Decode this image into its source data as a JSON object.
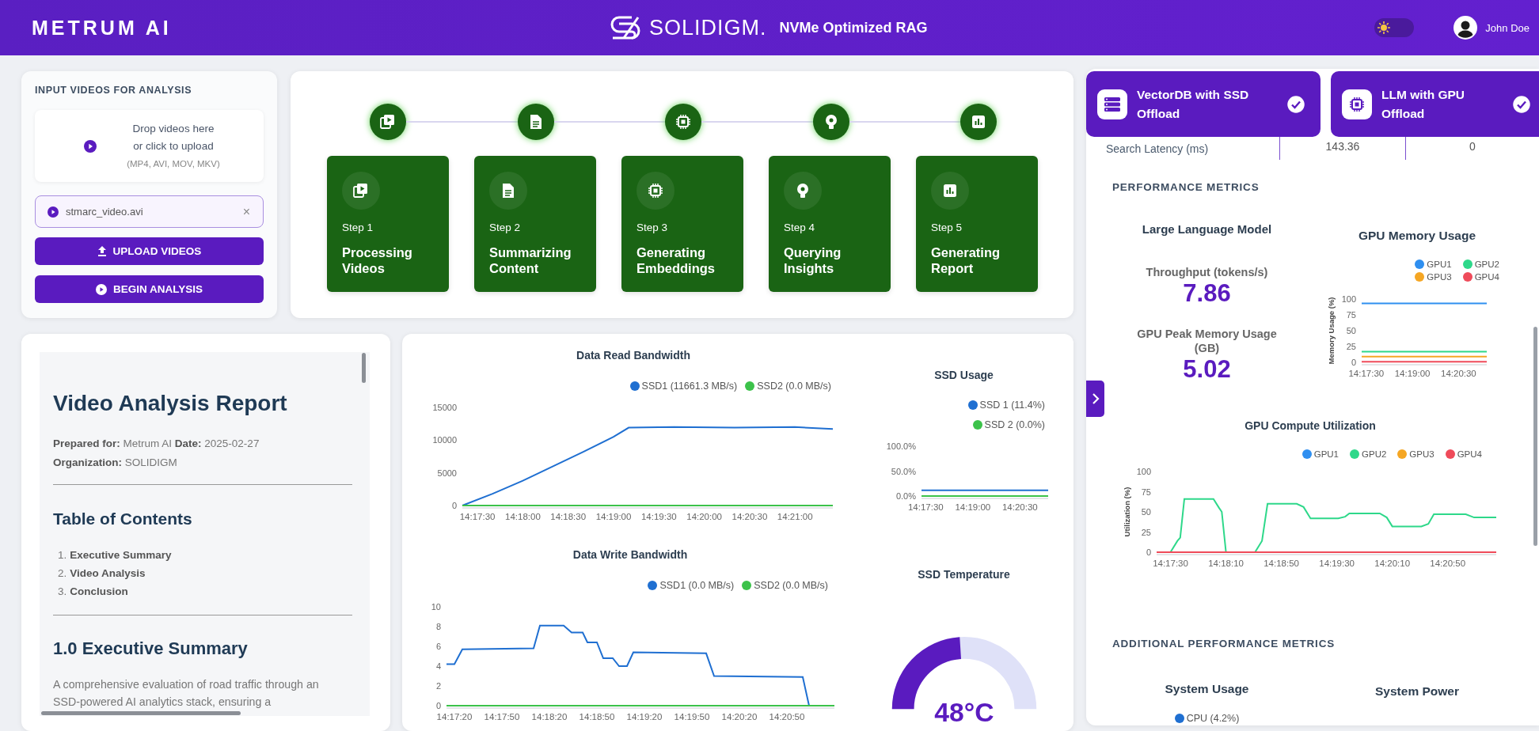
{
  "header": {
    "logo": "METRUM AI",
    "brand": "SOLIDIGM.",
    "app_title": "NVMe Optimized RAG",
    "theme_toggle": {
      "on": false
    },
    "user": "John Doe"
  },
  "input_panel": {
    "heading": "INPUT VIDEOS FOR ANALYSIS",
    "drop_zone": {
      "lines": [
        "Drop videos here",
        "or click to upload"
      ],
      "formats": "(MP4, AVI, MOV, MKV)"
    },
    "files": [
      {
        "name": "stmarc_video.avi",
        "remove": "×"
      }
    ],
    "buttons": [
      {
        "kind": "upload",
        "label": "UPLOAD VIDEOS"
      },
      {
        "kind": "analyze",
        "label": "BEGIN ANALYSIS"
      }
    ]
  },
  "pipeline": {
    "steps": [
      {
        "kind": "video",
        "step": "Step 1",
        "title": "Processing Videos",
        "completed": true
      },
      {
        "kind": "document",
        "step": "Step 2",
        "title": "Summarizing Content",
        "completed": true
      },
      {
        "kind": "chip",
        "step": "Step 3",
        "title": "Generating Embeddings",
        "completed": true
      },
      {
        "kind": "bulb",
        "step": "Step 4",
        "title": "Querying Insights",
        "completed": true
      },
      {
        "kind": "chart",
        "step": "Step 5",
        "title": "Generating Report",
        "completed": true
      }
    ]
  },
  "report": {
    "title": "Video Analysis Report",
    "meta": [
      "**Prepared for:** Metrum AI **Date:** 2025-02-27",
      "**Organization:** SOLIDIGM"
    ],
    "toc_title": "Table of Contents",
    "toc": [
      {
        "number": "1.",
        "label": "Executive Summary"
      },
      {
        "number": "2.",
        "label": "Video Analysis"
      },
      {
        "number": "3.",
        "label": "Conclusion"
      }
    ],
    "section_title": "1.0 Executive Summary",
    "paragraph": "A comprehensive evaluation of road traffic through an SSD-powered AI analytics stack, ensuring a"
  },
  "storage_charts": {
    "read_bandwidth": {
      "chart_data": {
        "type": "line",
        "title": "Data Read Bandwidth",
        "x": [
          51440,
          51460,
          51480,
          51500,
          51520,
          51540,
          51550,
          51580,
          51620,
          51660,
          51685
        ],
        "xlim": [
          51440,
          51685
        ],
        "ylim": [
          0,
          15000
        ],
        "legend": "top-right",
        "xticks": [
          {
            "value": 51450,
            "label": "14:17:30"
          },
          {
            "value": 51480,
            "label": "14:18:00"
          },
          {
            "value": 51510,
            "label": "14:18:30"
          },
          {
            "value": 51540,
            "label": "14:19:00"
          },
          {
            "value": 51570,
            "label": "14:19:30"
          },
          {
            "value": 51600,
            "label": "14:20:00"
          },
          {
            "value": 51630,
            "label": "14:20:30"
          },
          {
            "value": 51660,
            "label": "14:21:00"
          }
        ],
        "yticks": [
          0,
          5000,
          10000,
          15000
        ],
        "series": [
          {
            "name": "SSD1 (11661.3 MB/s)",
            "color": "#1f6fd1",
            "values": [
              0,
              1800,
              3800,
              6000,
              8200,
              10500,
              11900,
              12000,
              11900,
              12000,
              11700
            ]
          },
          {
            "name": "SSD2 (0.0 MB/s)",
            "color": "#3cc24a",
            "values": [
              0,
              0,
              0,
              0,
              0,
              0,
              0,
              0,
              0,
              0,
              0
            ]
          }
        ]
      }
    },
    "write_bandwidth": {
      "chart_data": {
        "type": "line",
        "title": "Data Write Bandwidth",
        "x": [
          51435,
          51440,
          51445,
          51490,
          51494,
          51509,
          51514,
          51521,
          51524,
          51530,
          51534,
          51540,
          51544,
          51549,
          51553,
          51599,
          51604,
          51660,
          51664,
          51680
        ],
        "xlim": [
          51435,
          51680
        ],
        "ylim": [
          0,
          10
        ],
        "legend": "top-right",
        "xticks": [
          {
            "value": 51440,
            "label": "14:17:20"
          },
          {
            "value": 51470,
            "label": "14:17:50"
          },
          {
            "value": 51500,
            "label": "14:18:20"
          },
          {
            "value": 51530,
            "label": "14:18:50"
          },
          {
            "value": 51560,
            "label": "14:19:20"
          },
          {
            "value": 51590,
            "label": "14:19:50"
          },
          {
            "value": 51620,
            "label": "14:20:20"
          },
          {
            "value": 51650,
            "label": "14:20:50"
          }
        ],
        "yticks": [
          0,
          2,
          4,
          6,
          8,
          10
        ],
        "series": [
          {
            "name": "SSD1 (0.0 MB/s)",
            "color": "#1f6fd1",
            "values": [
              4.2,
              4.2,
              5.7,
              5.8,
              8.1,
              8.1,
              7.4,
              7.4,
              6.4,
              6.4,
              4.8,
              4.8,
              4.0,
              4.0,
              5.4,
              5.3,
              3.0,
              2.9,
              0,
              0
            ]
          },
          {
            "name": "SSD2 (0.0 MB/s)",
            "color": "#3cc24a",
            "values": [
              0,
              0,
              0,
              0,
              0,
              0,
              0,
              0,
              0,
              0,
              0,
              0,
              0,
              0,
              0,
              0,
              0,
              0,
              0,
              0
            ]
          }
        ]
      }
    },
    "ssd_usage": {
      "chart_data": {
        "type": "line",
        "title": "SSD Usage",
        "x": [
          51442,
          51684
        ],
        "xlim": [
          51442,
          51684
        ],
        "ylim": [
          0,
          100
        ],
        "legend": "top-right",
        "xticks": [
          {
            "value": 51450,
            "label": "14:17:30"
          },
          {
            "value": 51540,
            "label": "14:19:00"
          },
          {
            "value": 51630,
            "label": "14:20:30"
          }
        ],
        "yticks": [
          {
            "value": 0,
            "label": "0.0%"
          },
          {
            "value": 50,
            "label": "50.0%"
          },
          {
            "value": 100,
            "label": "100.0%"
          }
        ],
        "series": [
          {
            "name": "SSD 1 (11.4%)",
            "color": "#1f6fd1",
            "values": [
              11.4,
              11.4
            ]
          },
          {
            "name": "SSD 2 (0.0%)",
            "color": "#3cc24a",
            "values": [
              0,
              0
            ]
          }
        ]
      }
    },
    "ssd_temperature": {
      "title": "SSD Temperature",
      "reading": "48°C"
    }
  },
  "results_panel": {
    "offload_cards": [
      {
        "kind": "database",
        "title": "VectorDB with SSD Offload",
        "checked": true
      },
      {
        "kind": "chip",
        "title": "LLM with GPU Offload",
        "checked": true
      }
    ],
    "latency_row": {
      "label": "Search Latency (ms)",
      "values": [
        "143.36",
        "0"
      ]
    },
    "performance_heading": "PERFORMANCE METRICS",
    "llm": {
      "title": "Large Language Model",
      "metrics": [
        {
          "label": "Throughput (tokens/s)",
          "value": "7.86"
        },
        {
          "label": "GPU Peak Memory Usage (GB)",
          "value": "5.02"
        }
      ]
    },
    "gpu_memory": {
      "chart_data": {
        "type": "line",
        "title": "GPU Memory Usage",
        "ylabel": "Memory Usage (%)",
        "x": [
          51441,
          51685
        ],
        "xlim": [
          51441,
          51685
        ],
        "ylim": [
          0,
          100
        ],
        "legend": "top-right",
        "xticks": [
          {
            "value": 51450,
            "label": "14:17:30"
          },
          {
            "value": 51540,
            "label": "14:19:00"
          },
          {
            "value": 51630,
            "label": "14:20:30"
          }
        ],
        "yticks": [
          0,
          25,
          50,
          75,
          100
        ],
        "series": [
          {
            "name": "GPU1",
            "color": "#2f8ff0",
            "values": [
              93,
              93
            ]
          },
          {
            "name": "GPU2",
            "color": "#2ed88a",
            "values": [
              17,
              17
            ]
          },
          {
            "name": "GPU3",
            "color": "#f5a623",
            "values": [
              9,
              9
            ]
          },
          {
            "name": "GPU4",
            "color": "#ef4b5a",
            "values": [
              1,
              1
            ]
          }
        ]
      }
    },
    "gpu_compute": {
      "chart_data": {
        "type": "line",
        "title": "GPU Compute Utilization",
        "ylabel": "Utilization (%)",
        "x": [
          51440,
          51450,
          51455,
          51457,
          51460,
          51481,
          51485,
          51487,
          51490,
          51511,
          51516,
          51520,
          51541,
          51546,
          51551,
          51571,
          51576,
          51579,
          51601,
          51606,
          51610,
          51631,
          51636,
          51640,
          51663,
          51669,
          51685
        ],
        "xlim": [
          51440,
          51685
        ],
        "ylim": [
          0,
          100
        ],
        "legend": "top-right",
        "xticks": [
          {
            "value": 51450,
            "label": "14:17:30"
          },
          {
            "value": 51490,
            "label": "14:18:10"
          },
          {
            "value": 51530,
            "label": "14:18:50"
          },
          {
            "value": 51570,
            "label": "14:19:30"
          },
          {
            "value": 51610,
            "label": "14:20:10"
          },
          {
            "value": 51650,
            "label": "14:20:50"
          }
        ],
        "yticks": [
          0,
          25,
          50,
          75,
          100
        ],
        "series": [
          {
            "name": "GPU1",
            "color": "#2f8ff0",
            "values": [
              null,
              null,
              null,
              null,
              null,
              null,
              null,
              null,
              null,
              null,
              null,
              null,
              null,
              null,
              null,
              null,
              null,
              null,
              null,
              null,
              null,
              null,
              null,
              null,
              null,
              null,
              null
            ]
          },
          {
            "name": "GPU2",
            "color": "#2ed88a",
            "values": [
              0,
              0,
              14,
              18,
              66,
              66,
              55,
              50,
              0,
              0,
              14,
              60,
              60,
              56,
              42,
              42,
              44,
              48,
              48,
              43,
              32,
              32,
              35,
              47,
              47,
              43,
              43
            ]
          },
          {
            "name": "GPU3",
            "color": "#f5a623",
            "values": [
              null,
              null,
              null,
              null,
              null,
              null,
              null,
              null,
              null,
              null,
              null,
              null,
              null,
              null,
              null,
              null,
              null,
              null,
              null,
              null,
              null,
              null,
              null,
              null,
              null,
              null,
              null
            ]
          },
          {
            "name": "GPU4",
            "color": "#ef4b5a",
            "values": [
              0,
              0,
              0,
              0,
              0,
              0,
              0,
              0,
              0,
              0,
              0,
              0,
              0,
              0,
              0,
              0,
              0,
              0,
              0,
              0,
              0,
              0,
              0,
              0,
              0,
              0,
              0
            ]
          }
        ]
      }
    },
    "additional_heading": "ADDITIONAL PERFORMANCE METRICS",
    "system_usage": {
      "title": "System Usage",
      "legend": [
        {
          "label": "CPU (4.2%)",
          "color": "#1f6fd1"
        }
      ]
    },
    "system_power": {
      "title": "System Power"
    }
  }
}
